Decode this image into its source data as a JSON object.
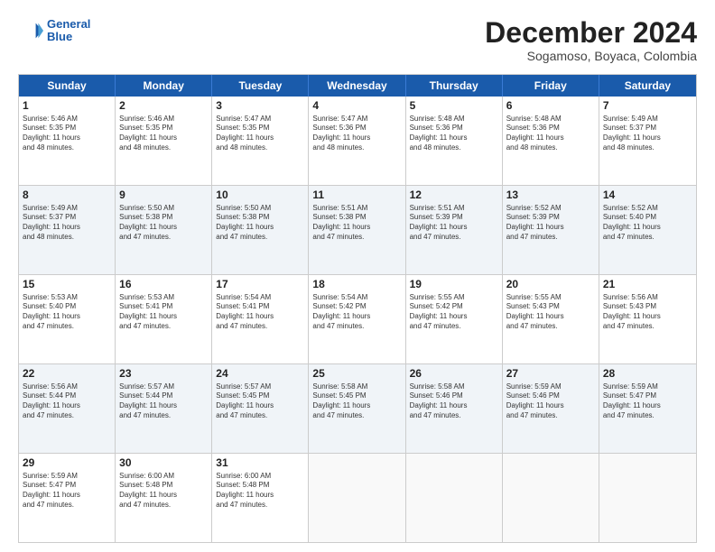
{
  "logo": {
    "line1": "General",
    "line2": "Blue"
  },
  "title": "December 2024",
  "subtitle": "Sogamoso, Boyaca, Colombia",
  "header_days": [
    "Sunday",
    "Monday",
    "Tuesday",
    "Wednesday",
    "Thursday",
    "Friday",
    "Saturday"
  ],
  "weeks": [
    [
      {
        "day": "1",
        "text": "Sunrise: 5:46 AM\nSunset: 5:35 PM\nDaylight: 11 hours\nand 48 minutes."
      },
      {
        "day": "2",
        "text": "Sunrise: 5:46 AM\nSunset: 5:35 PM\nDaylight: 11 hours\nand 48 minutes."
      },
      {
        "day": "3",
        "text": "Sunrise: 5:47 AM\nSunset: 5:35 PM\nDaylight: 11 hours\nand 48 minutes."
      },
      {
        "day": "4",
        "text": "Sunrise: 5:47 AM\nSunset: 5:36 PM\nDaylight: 11 hours\nand 48 minutes."
      },
      {
        "day": "5",
        "text": "Sunrise: 5:48 AM\nSunset: 5:36 PM\nDaylight: 11 hours\nand 48 minutes."
      },
      {
        "day": "6",
        "text": "Sunrise: 5:48 AM\nSunset: 5:36 PM\nDaylight: 11 hours\nand 48 minutes."
      },
      {
        "day": "7",
        "text": "Sunrise: 5:49 AM\nSunset: 5:37 PM\nDaylight: 11 hours\nand 48 minutes."
      }
    ],
    [
      {
        "day": "8",
        "text": "Sunrise: 5:49 AM\nSunset: 5:37 PM\nDaylight: 11 hours\nand 48 minutes."
      },
      {
        "day": "9",
        "text": "Sunrise: 5:50 AM\nSunset: 5:38 PM\nDaylight: 11 hours\nand 47 minutes."
      },
      {
        "day": "10",
        "text": "Sunrise: 5:50 AM\nSunset: 5:38 PM\nDaylight: 11 hours\nand 47 minutes."
      },
      {
        "day": "11",
        "text": "Sunrise: 5:51 AM\nSunset: 5:38 PM\nDaylight: 11 hours\nand 47 minutes."
      },
      {
        "day": "12",
        "text": "Sunrise: 5:51 AM\nSunset: 5:39 PM\nDaylight: 11 hours\nand 47 minutes."
      },
      {
        "day": "13",
        "text": "Sunrise: 5:52 AM\nSunset: 5:39 PM\nDaylight: 11 hours\nand 47 minutes."
      },
      {
        "day": "14",
        "text": "Sunrise: 5:52 AM\nSunset: 5:40 PM\nDaylight: 11 hours\nand 47 minutes."
      }
    ],
    [
      {
        "day": "15",
        "text": "Sunrise: 5:53 AM\nSunset: 5:40 PM\nDaylight: 11 hours\nand 47 minutes."
      },
      {
        "day": "16",
        "text": "Sunrise: 5:53 AM\nSunset: 5:41 PM\nDaylight: 11 hours\nand 47 minutes."
      },
      {
        "day": "17",
        "text": "Sunrise: 5:54 AM\nSunset: 5:41 PM\nDaylight: 11 hours\nand 47 minutes."
      },
      {
        "day": "18",
        "text": "Sunrise: 5:54 AM\nSunset: 5:42 PM\nDaylight: 11 hours\nand 47 minutes."
      },
      {
        "day": "19",
        "text": "Sunrise: 5:55 AM\nSunset: 5:42 PM\nDaylight: 11 hours\nand 47 minutes."
      },
      {
        "day": "20",
        "text": "Sunrise: 5:55 AM\nSunset: 5:43 PM\nDaylight: 11 hours\nand 47 minutes."
      },
      {
        "day": "21",
        "text": "Sunrise: 5:56 AM\nSunset: 5:43 PM\nDaylight: 11 hours\nand 47 minutes."
      }
    ],
    [
      {
        "day": "22",
        "text": "Sunrise: 5:56 AM\nSunset: 5:44 PM\nDaylight: 11 hours\nand 47 minutes."
      },
      {
        "day": "23",
        "text": "Sunrise: 5:57 AM\nSunset: 5:44 PM\nDaylight: 11 hours\nand 47 minutes."
      },
      {
        "day": "24",
        "text": "Sunrise: 5:57 AM\nSunset: 5:45 PM\nDaylight: 11 hours\nand 47 minutes."
      },
      {
        "day": "25",
        "text": "Sunrise: 5:58 AM\nSunset: 5:45 PM\nDaylight: 11 hours\nand 47 minutes."
      },
      {
        "day": "26",
        "text": "Sunrise: 5:58 AM\nSunset: 5:46 PM\nDaylight: 11 hours\nand 47 minutes."
      },
      {
        "day": "27",
        "text": "Sunrise: 5:59 AM\nSunset: 5:46 PM\nDaylight: 11 hours\nand 47 minutes."
      },
      {
        "day": "28",
        "text": "Sunrise: 5:59 AM\nSunset: 5:47 PM\nDaylight: 11 hours\nand 47 minutes."
      }
    ],
    [
      {
        "day": "29",
        "text": "Sunrise: 5:59 AM\nSunset: 5:47 PM\nDaylight: 11 hours\nand 47 minutes."
      },
      {
        "day": "30",
        "text": "Sunrise: 6:00 AM\nSunset: 5:48 PM\nDaylight: 11 hours\nand 47 minutes."
      },
      {
        "day": "31",
        "text": "Sunrise: 6:00 AM\nSunset: 5:48 PM\nDaylight: 11 hours\nand 47 minutes."
      },
      {
        "day": "",
        "text": ""
      },
      {
        "day": "",
        "text": ""
      },
      {
        "day": "",
        "text": ""
      },
      {
        "day": "",
        "text": ""
      }
    ]
  ]
}
